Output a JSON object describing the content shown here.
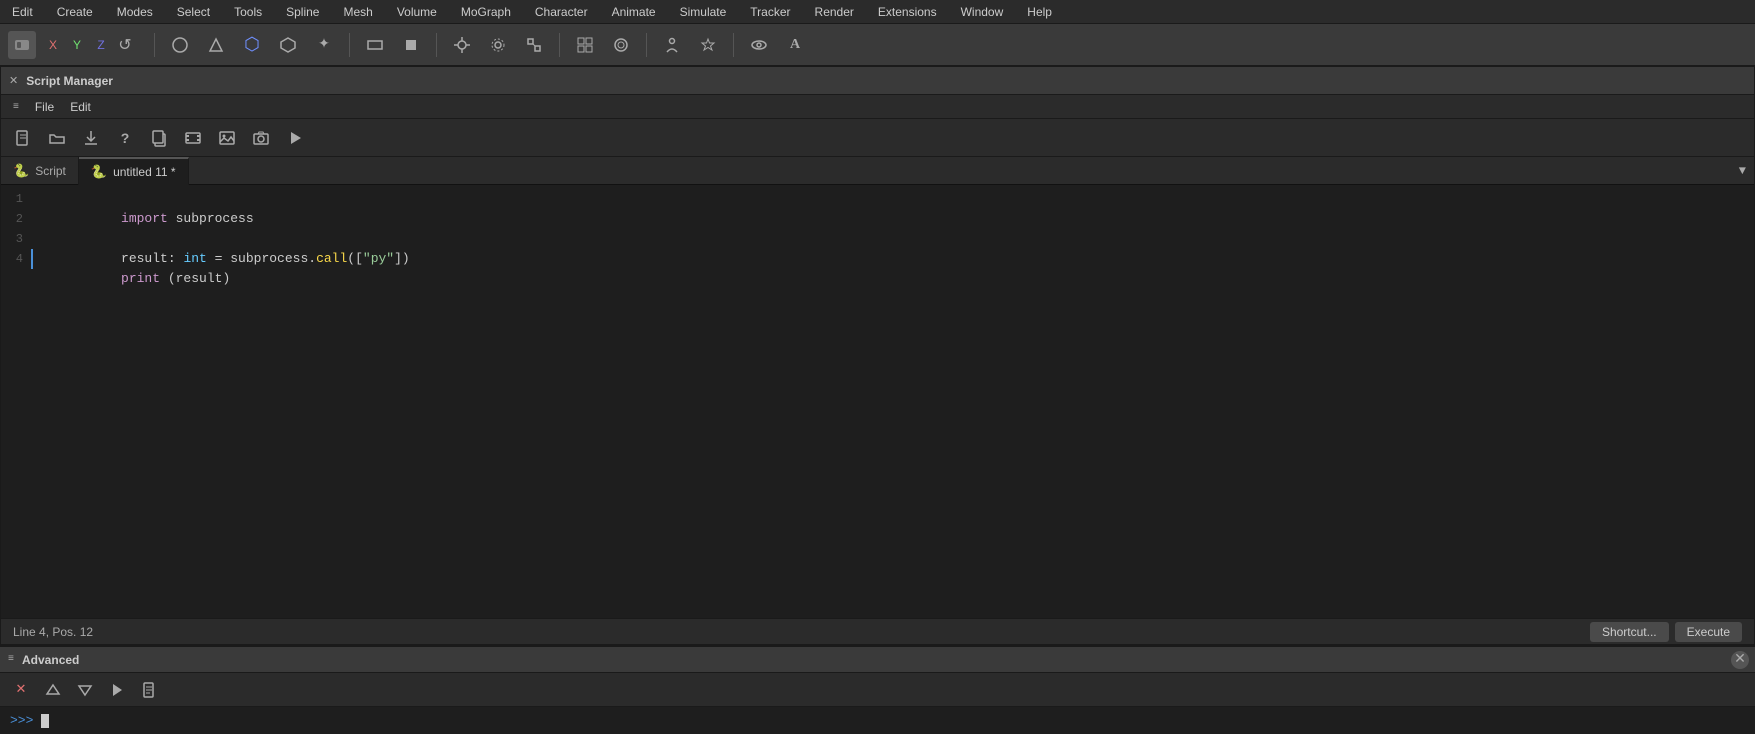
{
  "menubar": {
    "items": [
      "Edit",
      "Create",
      "Modes",
      "Select",
      "Tools",
      "Spline",
      "Mesh",
      "Volume",
      "MoGraph",
      "Character",
      "Animate",
      "Simulate",
      "Tracker",
      "Render",
      "Extensions",
      "Window",
      "Help"
    ]
  },
  "toolbar": {
    "back_icon": "⬡",
    "axis": [
      "X",
      "Y",
      "Z"
    ],
    "axis_icon": "↩",
    "tools": [
      "⊙",
      "⊕",
      "⬡",
      "⬣",
      "✦",
      "▭",
      "▪",
      "◌",
      "⊙",
      "⊞",
      "⊡",
      "⚙",
      "◈",
      "⚙",
      "○",
      "A"
    ]
  },
  "panel": {
    "title": "Script Manager",
    "menu_icon": "≡",
    "file_label": "File",
    "edit_label": "Edit",
    "script_tools": [
      "📄",
      "📁",
      "⬇",
      "?",
      "📋",
      "🎬",
      "🖼",
      "📷",
      "▶"
    ],
    "tabs": [
      {
        "label": "Script",
        "icon": "🐍",
        "active": false
      },
      {
        "label": "untitled 11 *",
        "icon": "🐍",
        "active": true
      }
    ],
    "dropdown_icon": "▼"
  },
  "code": {
    "lines": [
      {
        "num": 1,
        "active": false,
        "content": "import subprocess"
      },
      {
        "num": 2,
        "active": false,
        "content": ""
      },
      {
        "num": 3,
        "active": false,
        "content": "result: int = subprocess.call([\"py\"])"
      },
      {
        "num": 4,
        "active": true,
        "content": "print (result)"
      }
    ]
  },
  "statusbar": {
    "position": "Line 4, Pos. 12",
    "shortcut_btn": "Shortcut...",
    "execute_btn": "Execute"
  },
  "advanced": {
    "title": "Advanced",
    "menu_icon": "≡",
    "console_tools": [
      "✕",
      "△",
      "⬇",
      "▶",
      "📄"
    ],
    "prompt": ">>>",
    "close_icon": "✕"
  }
}
